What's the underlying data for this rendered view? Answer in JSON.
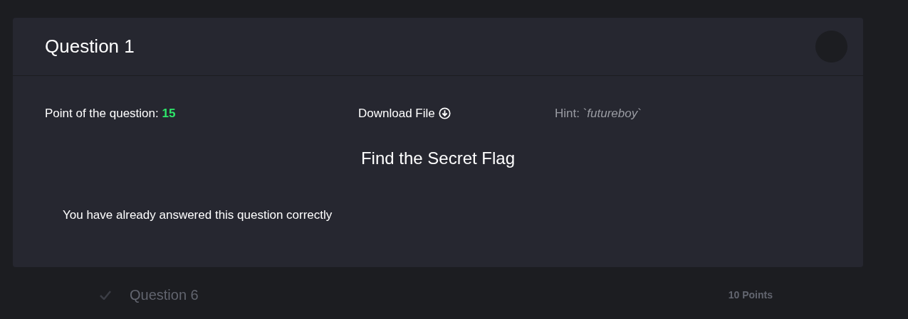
{
  "background": {
    "rows": [
      {
        "title": "Question 6",
        "answered": true,
        "points": "10 Points"
      }
    ]
  },
  "modal": {
    "title": "Question 1",
    "points_label": "Point of the question:",
    "points": "15",
    "download": "Download File",
    "hint": "Hint: `*futureboy*`",
    "heading": "Find the Secret Flag",
    "message": "You have already answered this question correctly"
  }
}
